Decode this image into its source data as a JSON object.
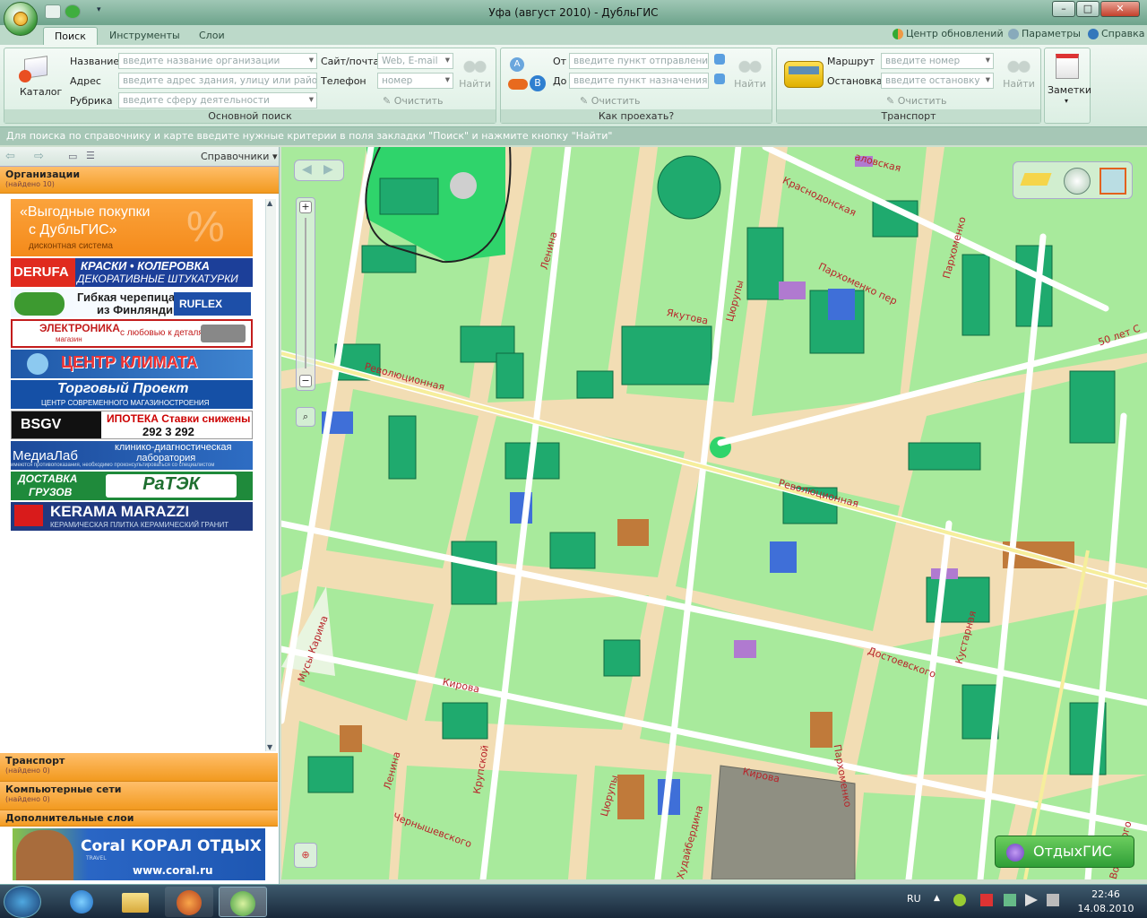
{
  "window": {
    "title": "Уфа (август 2010) - ДубльГИС"
  },
  "ribbon_tabs": [
    {
      "label": "Поиск"
    },
    {
      "label": "Инструменты"
    },
    {
      "label": "Слои"
    }
  ],
  "ribbon_links": {
    "updates": "Центр обновлений",
    "settings": "Параметры",
    "help": "Справка"
  },
  "search_group": {
    "catalog_label": "Каталог",
    "name_label": "Название",
    "name_placeholder": "введите название организации",
    "address_label": "Адрес",
    "address_placeholder": "введите адрес здания, улицу или район",
    "rubric_label": "Рубрика",
    "rubric_placeholder": "введите сферу деятельности",
    "site_label": "Сайт/почта",
    "site_placeholder": "Web, E-mail",
    "phone_label": "Телефон",
    "phone_placeholder": "номер",
    "clear_label": "Очистить",
    "find_label": "Найти",
    "caption": "Основной поиск"
  },
  "route_group": {
    "from_label": "От",
    "from_placeholder": "введите пункт отправления",
    "to_label": "До",
    "to_placeholder": "введите пункт назначения",
    "clear_label": "Очистить",
    "find_label": "Найти",
    "caption": "Как проехать?"
  },
  "transport_group": {
    "route_label": "Маршрут",
    "route_placeholder": "введите номер",
    "stop_label": "Остановка",
    "stop_placeholder": "введите остановку",
    "clear_label": "Очистить",
    "find_label": "Найти",
    "caption": "Транспорт"
  },
  "notes_label": "Заметки",
  "status_hint": "Для поиска по справочнику и карте введите нужные критерии в поля закладки \"Поиск\" и нажмите кнопку \"Найти\"",
  "sidebar": {
    "directories_label": "Справочники",
    "sections": [
      {
        "title": "Организации",
        "count": "(найдено 10)"
      },
      {
        "title": "Транспорт",
        "count": "(найдено 0)"
      },
      {
        "title": "Компьютерные сети",
        "count": "(найдено 0)"
      },
      {
        "title": "Дополнительные слои",
        "count": ""
      }
    ],
    "ads": [
      {
        "l1": "«Выгодные покупки",
        "l2": "с ДубльГИС»",
        "l3": "дисконтная система"
      },
      {
        "l1": "DERUFA",
        "l2": "КРАСКИ • КОЛЕРОВКА",
        "l3": "ДЕКОРАТИВНЫЕ ШТУКАТУРКИ"
      },
      {
        "l1": "Гибкая черепица",
        "l2": "из Финляндии",
        "l3": "RUFLEX"
      },
      {
        "l1": "ЭЛЕКТРОНИКА",
        "l2": "магазин",
        "l3": "с любовью к деталям"
      },
      {
        "l1": "ЦЕНТР КЛИМАТА"
      },
      {
        "l1": "Торговый Проект",
        "l2": "ЦЕНТР СОВРЕМЕННОГО МАГАЗИНОСТРОЕНИЯ"
      },
      {
        "l1": "BSGV",
        "l2": "ИПОТЕКА Ставки снижены",
        "l3": "292 3 292"
      },
      {
        "l1": "МедиаЛаб",
        "l2": "клинико-диагностическая",
        "l3": "лаборатория",
        "l4": "имеются противопоказания, необходимо проконсультироваться со специалистом"
      },
      {
        "l1": "ДОСТАВКА",
        "l2": "ГРУЗОВ",
        "l3": "РаТЭК"
      },
      {
        "l1": "KERAMA MARAZZI",
        "l2": "КЕРАМИЧЕСКАЯ ПЛИТКА КЕРАМИЧЕСКИЙ ГРАНИТ"
      }
    ],
    "bottom_ad": {
      "brand": "Coral",
      "sub": "TRAVEL",
      "name": "КОРАЛ ОТДЫХ",
      "url": "www.coral.ru"
    }
  },
  "map": {
    "streets": {
      "revolutsionnaya_w": "Революционная",
      "revolutsionnaya_e": "Революционная",
      "lenina_top": "Ленина",
      "lenina_bottom": "Ленина",
      "yakutova": "Якутова",
      "tsyurupy_top": "Цюрупы",
      "tsyurupy_bottom": "Цюрупы",
      "krasnodonskaya": "Краснодонская",
      "parkhomenko_per": "Пархоменко пер",
      "parkhomenko_top": "Пархоменко",
      "parkhomenko_bottom": "Пархоменко",
      "fifty_let": "50 лет С",
      "kirova_w": "Кирова",
      "kirova_e": "Кирова",
      "musy_karimova": "Мусы Карима",
      "krupskoy": "Крупской",
      "chernyshevskogo": "Чернышевского",
      "khudaiberdina": "Худайбердина",
      "dostoevskogo": "Достоевского",
      "kustarnaya": "Кустарная",
      "vorovskogo": "Воровского",
      "chkalovskaya": "аловская"
    },
    "otdyhgis_label": "ОтдыхГИС"
  },
  "taskbar": {
    "lang": "RU",
    "time": "22:46",
    "date": "14.08.2010"
  }
}
